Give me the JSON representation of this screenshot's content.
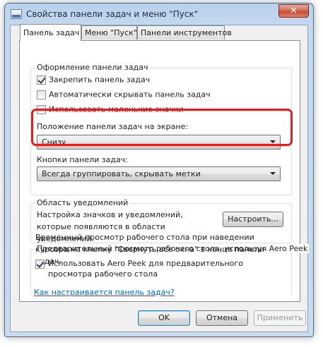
{
  "window": {
    "title": "Свойства панели задач и меню \"Пуск\"",
    "close_label": "✕"
  },
  "tabs": [
    {
      "label": "Панель задач",
      "active": true
    },
    {
      "label": "Меню \"Пуск\"",
      "active": false
    },
    {
      "label": "Панели инструментов",
      "active": false
    }
  ],
  "appearance": {
    "title": "Оформление панели задач",
    "checkboxes": [
      {
        "label": "Закрепить панель задач",
        "checked": true
      },
      {
        "label": "Автоматически скрывать панель задач",
        "checked": false
      },
      {
        "label": "Использовать маленькие значки",
        "checked": false
      }
    ],
    "position_label": "Положение панели задач на экране:",
    "position_value": "Снизу",
    "buttons_label": "Кнопки панели задач:",
    "buttons_value": "Всегда группировать, скрывать метки"
  },
  "notifications": {
    "title": "Область уведомлений",
    "description": "Настройка значков и уведомлений, которые появляются в области уведомлений.",
    "customize_button": "Настроить..."
  },
  "aero_peek": {
    "title": "Предварительный просмотр рабочего стола, используя Aero Peek",
    "description": "Временный просмотр рабочего стола при наведении курсора на кнопку \"Свернуть все окна\" в конце панели задач.",
    "checkbox_label": "Использовать Aero Peek для предварительного просмотра рабочего стола",
    "checkbox_checked": true
  },
  "help_link": "Как настраивается панель задач?",
  "footer": {
    "ok": "OK",
    "cancel": "Отмена",
    "apply": "Применить"
  },
  "colors": {
    "highlight": "#dd2020",
    "link": "#0066cc"
  }
}
